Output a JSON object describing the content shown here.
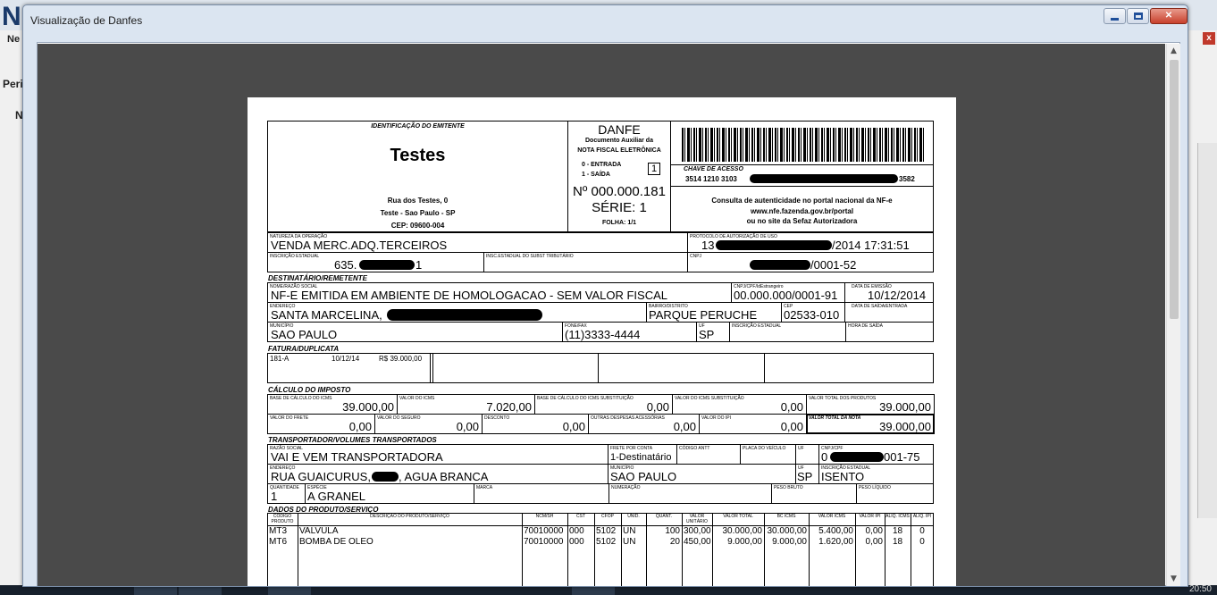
{
  "background_app": {
    "logo": "N",
    "label1": "Ne",
    "label2": "Peri",
    "label3": "N",
    "close": "x"
  },
  "window": {
    "title": "Visualização de Danfes",
    "close_label": "✕"
  },
  "taskbar": {
    "clock": "20:50"
  },
  "danfe": {
    "emitente_label": "IDENTIFICAÇÃO DO EMITENTE",
    "emitente_name": "Testes",
    "emitente_addr1": "Rua dos Testes, 0",
    "emitente_addr2": "Teste - Sao Paulo - SP",
    "emitente_cep": "CEP: 09600-004",
    "danfe_title": "DANFE",
    "danfe_sub1": "Documento Auxiliar da",
    "danfe_sub2": "NOTA FISCAL ELETRÔNICA",
    "entrada": "0 - ENTRADA",
    "saida": "1 - SAÍDA",
    "tipo": "1",
    "numero": "Nº 000.000.181",
    "serie": "SÉRIE: 1",
    "folha": "FOLHA: 1/1",
    "chave_label": "CHAVE DE ACESSO",
    "chave_start": "3514 1210 3103",
    "chave_end": "3582",
    "consulta1": "Consulta de autenticidade no portal nacional da NF-e",
    "consulta2": "www.nfe.fazenda.gov.br/portal",
    "consulta3": "ou no site da Sefaz Autorizadora",
    "natureza_label": "NATUREZA DA OPERAÇÃO",
    "natureza": "VENDA MERC.ADQ.TERCEIROS",
    "protocolo_label": "PROTOCOLO DE AUTORIZAÇÃO DE USO",
    "protocolo_start": "13",
    "protocolo_end": "/2014 17:31:51",
    "ie_label": "INSCRIÇÃO ESTADUAL",
    "ie_start": "635.",
    "ie_end": "1",
    "iest_label": "INSC.ESTADUAL DO SUBST TRIBUTÁRIO",
    "cnpj_label": "CNPJ",
    "cnpj_end": "/0001-52",
    "dest_section": "DESTINATÁRIO/REMETENTE",
    "dest_nome_label": "NOME/RAZÃO SOCIAL",
    "dest_nome": "NF-E EMITIDA EM AMBIENTE DE HOMOLOGACAO - SEM VALOR FISCAL",
    "dest_cnpj_label": "CNPJ/CPF/IdEstrangeiro",
    "dest_cnpj": "00.000.000/0001-91",
    "emissao_label": "DATA DE EMISSÃO",
    "emissao": "10/12/2014",
    "endereco_label": "ENDEREÇO",
    "endereco": "SANTA MARCELINA,",
    "bairro_label": "BAIRRO/DISTRITO",
    "bairro": "PARQUE PERUCHE",
    "cep_label": "CEP",
    "cep": "02533-010",
    "saida_label": "DATA DE SAÍDA/ENTRADA",
    "municipio_label": "MUNICÍPIO",
    "municipio": "SAO PAULO",
    "fone_label": "FONE/FAX",
    "fone": "(11)3333-4444",
    "uf_label": "UF",
    "uf": "SP",
    "dest_ie_label": "INSCRIÇÃO ESTADUAL",
    "hora_label": "HORA DE SAÍDA",
    "fatura_section": "FATURA/DUPLICATA",
    "fatura_num": "181-A",
    "fatura_data": "10/12/14",
    "fatura_valor": "R$ 39.000,00",
    "calc_section": "CÁLCULO DO IMPOSTO",
    "calc_labels": [
      "BASE DE CÁLCULO DO ICMS",
      "VALOR DO ICMS",
      "BASE DE CÁLCULO DO ICMS SUBSTITUIÇÃO",
      "VALOR DO ICMS SUBSTITUIÇÃO",
      "VALOR TOTAL DOS PRODUTOS"
    ],
    "calc_values": [
      "39.000,00",
      "7.020,00",
      "0,00",
      "0,00",
      "39.000,00"
    ],
    "calc2_labels": [
      "VALOR DO FRETE",
      "VALOR DO SEGURO",
      "DESCONTO",
      "OUTRAS DESPESAS ACESSÓRIAS",
      "VALOR DO IPI",
      "VALOR TOTAL DA NOTA"
    ],
    "calc2_values": [
      "0,00",
      "0,00",
      "0,00",
      "0,00",
      "0,00",
      "39.000,00"
    ],
    "transp_section": "TRANSPORTADOR/VOLUMES TRANSPORTADOS",
    "transp_nome_label": "RAZÃO SOCIAL",
    "transp_nome": "VAI E VEM TRANSPORTADORA",
    "frete_label": "FRETE POR CONTA",
    "frete": "1-Destinatário",
    "antt_label": "CÓDIGO ANTT",
    "placa_label": "PLACA DO VEÍCULO",
    "t_uf_label": "UF",
    "t_cnpj_label": "CNPJ/CPF",
    "t_cnpj_start": "0",
    "t_cnpj_end": "001-75",
    "t_end_label": "ENDEREÇO",
    "t_end_start": "RUA GUAICURUS,",
    "t_end_end": ", AGUA BRANCA",
    "t_mun_label": "MUNICÍPIO",
    "t_mun": "SAO PAULO",
    "t_uf2_label": "UF",
    "t_uf": "SP",
    "t_ie_label": "INSCRIÇÃO ESTADUAL",
    "t_ie": "ISENTO",
    "qtd_label": "QUANTIDADE",
    "qtd": "1",
    "especie_label": "ESPÉCIE",
    "especie": "A GRANEL",
    "marca_label": "MARCA",
    "numeracao_label": "NUMERAÇÃO",
    "pbruto_label": "PESO BRUTO",
    "pliq_label": "PESO LÍQUIDO",
    "prod_section": "DADOS DO PRODUTO/SERVIÇO",
    "prod_headers": [
      "CÓDIGO PRODUTO",
      "DESCRIÇÃO DO PRODUTO/SERVIÇO",
      "NCM/SH",
      "CST",
      "CFOP",
      "UNID.",
      "QUANT.",
      "VALOR UNITÁRIO",
      "VALOR TOTAL",
      "BC ICMS",
      "VALOR ICMS",
      "VALOR IPI",
      "ALIQ. ICMS",
      "ALIQ. IPI"
    ],
    "prod_rows": [
      [
        "MT3",
        "VALVULA",
        "70010000",
        "000",
        "5102",
        "UN",
        "100",
        "300,00",
        "30.000,00",
        "30.000,00",
        "5.400,00",
        "0,00",
        "18",
        "0"
      ],
      [
        "MT6",
        "BOMBA DE OLEO",
        "70010000",
        "000",
        "5102",
        "UN",
        "20",
        "450,00",
        "9.000,00",
        "9.000,00",
        "1.620,00",
        "0,00",
        "18",
        "0"
      ]
    ]
  }
}
